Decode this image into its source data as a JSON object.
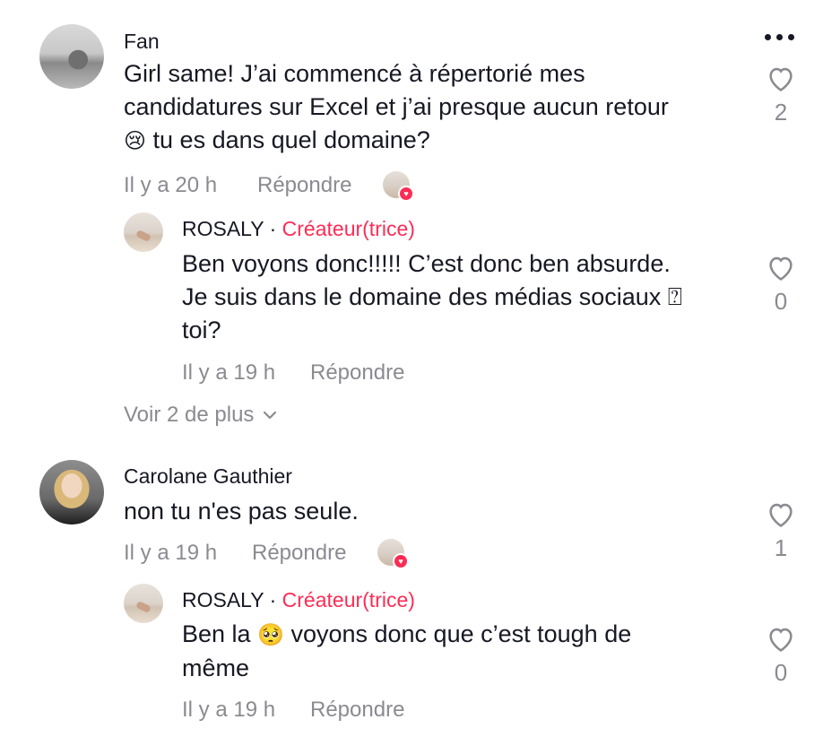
{
  "comments": [
    {
      "author": "Fan",
      "text_line1": "Girl same! J’ai commencé à répertorié mes",
      "text_line2": "candidatures sur Excel et j’ai presque aucun retour",
      "text_line3_emoji": "😢",
      "text_line3": " tu es dans quel domaine?",
      "time": "Il y a 20 h",
      "reply_label": "Répondre",
      "likes": "2",
      "replies": [
        {
          "author": "ROSALY",
          "separator": " · ",
          "badge": "Créateur(trice)",
          "text_line1": "Ben voyons donc!!!!! C’est donc ben absurde.",
          "text_line2": "Je suis dans le domaine des médias sociaux ⍰",
          "text_line3": "toi?",
          "time": "Il y a 19 h",
          "reply_label": "Répondre",
          "likes": "0"
        }
      ],
      "view_more": "Voir 2 de plus"
    },
    {
      "author": "Carolane Gauthier",
      "text_line1": "non tu n'es pas seule.",
      "time": "Il y a 19 h",
      "reply_label": "Répondre",
      "likes": "1",
      "replies": [
        {
          "author": "ROSALY",
          "separator": " · ",
          "badge": "Créateur(trice)",
          "text_line1_pre": "Ben la ",
          "text_line1_emoji": "🥺",
          "text_line1_post": " voyons donc que c’est tough de",
          "text_line2": "même",
          "time": "Il y a 19 h",
          "reply_label": "Répondre",
          "likes": "0"
        }
      ]
    }
  ],
  "icons": {
    "more": "more-options-icon",
    "like": "heart-outline-icon",
    "chevron": "chevron-down-icon",
    "creator_liked": "creator-liked-heart-icon"
  },
  "colors": {
    "accent": "#fe2c55",
    "muted": "#8a8b91",
    "text": "#161823"
  }
}
